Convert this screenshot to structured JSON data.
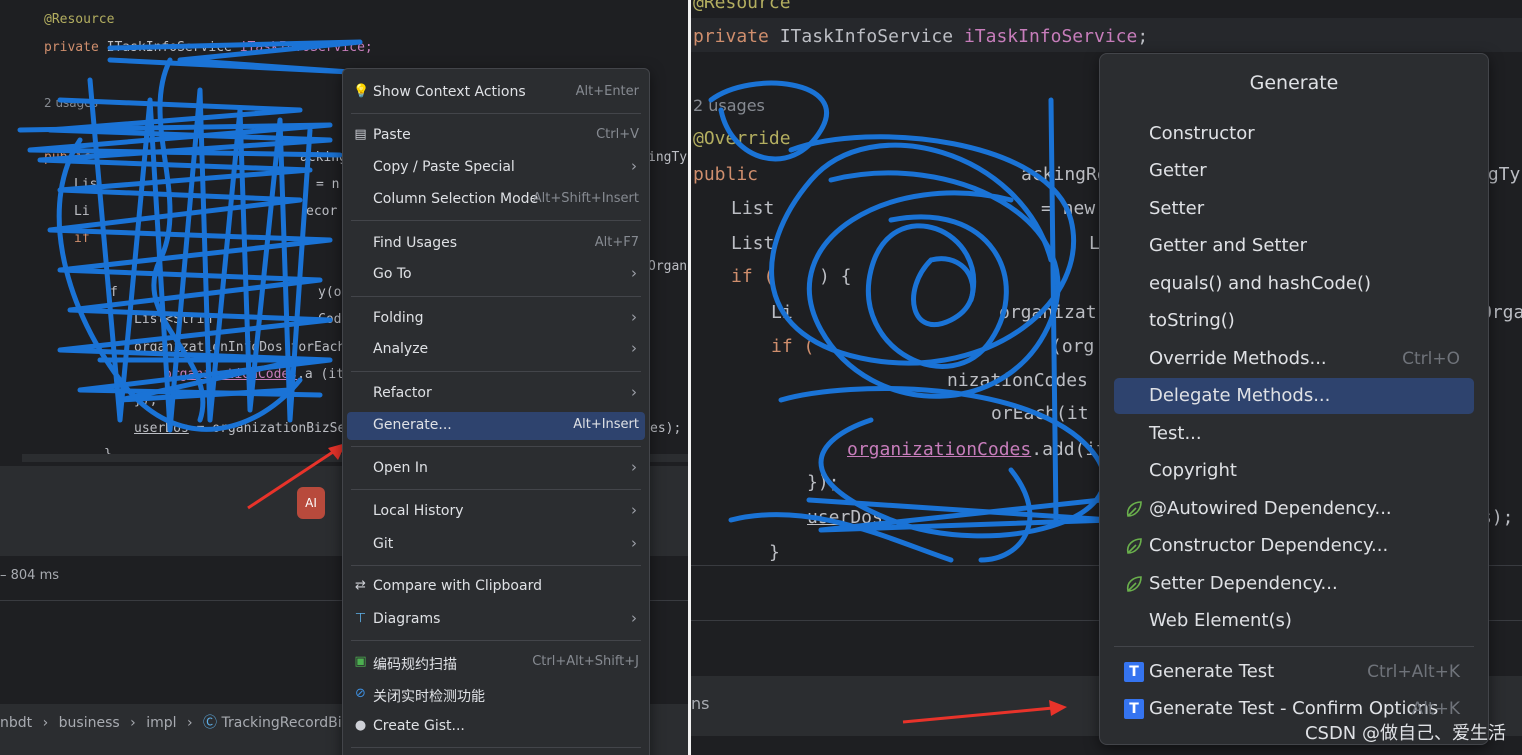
{
  "left": {
    "code": {
      "annotation": "@Resource",
      "field_decl_prefix": "private ",
      "field_decl_type": "ITaskInfoService",
      "field_decl_name": "iTaskInfoService;",
      "usages": "2 usages",
      "l_public": "public",
      "l_partial1": "ackingRe",
      "l_partial2": "ingTyp",
      "l_list1": "Lis",
      "l_list1_end": "= n",
      "l_list2": "Li",
      "l_list2_end": "ecor",
      "l_if": "if",
      "l_org1": "Organi",
      "l_loop": "f",
      "l_loop_end": "y(o",
      "l_list3": "List<Strin",
      "l_list3_end": "Cod",
      "l_foreach": "organizationInfoDos.forEach(",
      "l_add_field": "organizationCodes",
      "l_add_rest": ".a (it",
      "l_close1": "});",
      "l_userdos": "userDos",
      "l_userdos_rest": " = organizationBizSer",
      "l_userdos_end": "es);",
      "l_brace": "}"
    },
    "status_time": "– 804 ms",
    "breadcrumb": [
      "nbdt",
      "business",
      "impl",
      "TrackingRecordBizServiceI"
    ],
    "context_menu": [
      {
        "label": "Show Context Actions",
        "shortcut": "Alt+Enter",
        "icon": "lightbulb-icon"
      },
      {
        "label": "Paste",
        "shortcut": "Ctrl+V",
        "icon": "paste-icon"
      },
      {
        "label": "Copy / Paste Special",
        "submenu": true
      },
      {
        "label": "Column Selection Mode",
        "shortcut": "Alt+Shift+Insert"
      },
      {
        "label": "Find Usages",
        "shortcut": "Alt+F7"
      },
      {
        "label": "Go To",
        "submenu": true
      },
      {
        "label": "Folding",
        "submenu": true
      },
      {
        "label": "Analyze",
        "submenu": true
      },
      {
        "label": "Refactor",
        "submenu": true
      },
      {
        "label": "Generate...",
        "shortcut": "Alt+Insert",
        "selected": true
      },
      {
        "label": "Open In",
        "submenu": true
      },
      {
        "label": "Local History",
        "submenu": true
      },
      {
        "label": "Git",
        "submenu": true
      },
      {
        "label": "Compare with Clipboard",
        "icon": "compare-icon"
      },
      {
        "label": "Diagrams",
        "submenu": true,
        "icon": "diagram-icon"
      },
      {
        "label": "编码规约扫描",
        "shortcut": "Ctrl+Alt+Shift+J",
        "icon": "scan-icon"
      },
      {
        "label": "关闭实时检测功能",
        "icon": "disable-icon"
      },
      {
        "label": "Create Gist...",
        "icon": "github-icon"
      }
    ]
  },
  "right": {
    "code": {
      "annotation": "@Resource",
      "field_decl_prefix": "private ",
      "field_decl_type": "ITaskInfoService ",
      "field_decl_name": "iTaskInfoService",
      "field_decl_semi": ";",
      "usages": "2 usages",
      "override": "@Override",
      "r_public": "public",
      "r_partial1": "ackingRe",
      "r_partial2": "ngTy",
      "r_list1": "List",
      "r_list1_end": "= new",
      "r_list2": "List",
      "r_list2_end": "L",
      "r_if": "if (",
      "r_if_end": ") {",
      "r_list3": "Li",
      "r_list3_end": "organizat",
      "r_list3_tail": "Orga",
      "r_if2": "if (",
      "r_if2_end": "(org",
      "r_codes": "nizationCodes",
      "r_each": "orEach(it",
      "r_add_field": "organizationCodes",
      "r_add_rest": ".add(item",
      "r_close1": "});",
      "r_userdos": "userDos",
      "r_userdos_end": "s);",
      "r_brace": "}",
      "r_ns": "ns"
    },
    "generate_menu": {
      "title": "Generate",
      "items": [
        {
          "label": "Constructor"
        },
        {
          "label": "Getter"
        },
        {
          "label": "Setter"
        },
        {
          "label": "Getter and Setter"
        },
        {
          "label": "equals() and hashCode()"
        },
        {
          "label": "toString()"
        },
        {
          "label": "Override Methods...",
          "shortcut": "Ctrl+O"
        },
        {
          "label": "Delegate Methods...",
          "selected": true
        },
        {
          "label": "Test..."
        },
        {
          "label": "Copyright"
        },
        {
          "label": "@Autowired Dependency...",
          "icon": "spring-leaf-icon"
        },
        {
          "label": "Constructor Dependency...",
          "icon": "spring-leaf-icon"
        },
        {
          "label": "Setter Dependency...",
          "icon": "spring-leaf-icon"
        },
        {
          "label": "Web Element(s)"
        },
        {
          "label": "Generate Test",
          "shortcut": "Ctrl+Alt+K",
          "icon": "test-t-icon"
        },
        {
          "label": "Generate Test - Confirm Options",
          "shortcut": "Alt+K",
          "icon": "test-t-icon"
        }
      ]
    },
    "watermark": "CSDN @做自己、爱生活"
  },
  "colors": {
    "accent": "#2e436e",
    "scribble": "#1a73d6",
    "arrow": "#e8332a"
  }
}
